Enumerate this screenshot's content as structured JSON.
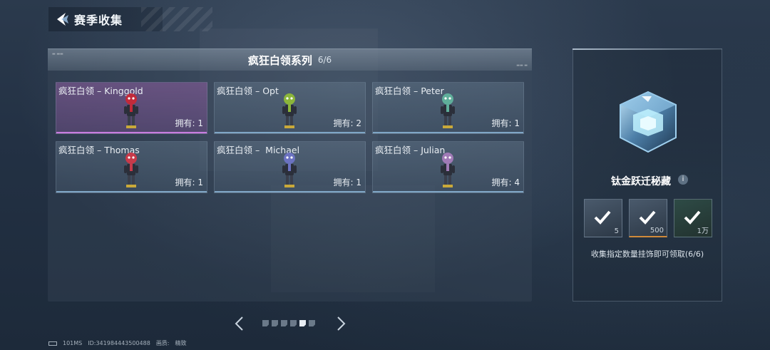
{
  "header": {
    "title": "赛季收集"
  },
  "panel": {
    "title": "疯狂白领系列",
    "count": "6/6",
    "cards": [
      {
        "name": "疯狂白领 – Kinggold",
        "owned": "拥有: 1",
        "selected": true,
        "color": "#c12a3a"
      },
      {
        "name": "疯狂白领 – Opt",
        "owned": "拥有: 2",
        "selected": false,
        "color": "#8bb53a"
      },
      {
        "name": "疯狂白领 – Peter",
        "owned": "拥有: 1",
        "selected": false,
        "color": "#5fae9a"
      },
      {
        "name": "疯狂白领 – Thomas",
        "owned": "拥有: 1",
        "selected": false,
        "color": "#c73a4a"
      },
      {
        "name": "疯狂白领 –  Michael",
        "owned": "拥有: 1",
        "selected": false,
        "color": "#6b72c0"
      },
      {
        "name": "疯狂白领 – Julian",
        "owned": "拥有: 4",
        "selected": false,
        "color": "#a07ab6"
      }
    ]
  },
  "pager": {
    "pages": 6,
    "active_index": 4
  },
  "reward": {
    "name": "钛金跃迁秘藏",
    "items": [
      {
        "qty": "5",
        "icon": "armor-icon"
      },
      {
        "qty": "500",
        "icon": "plate-icon"
      },
      {
        "qty": "1万",
        "icon": "cp-coin-icon"
      }
    ],
    "description": "收集指定数量挂饰即可领取(6/6)"
  },
  "footer": {
    "ping": "101MS",
    "id": "ID:341984443500488",
    "quality_label": "画质:",
    "quality_value": "精致"
  }
}
